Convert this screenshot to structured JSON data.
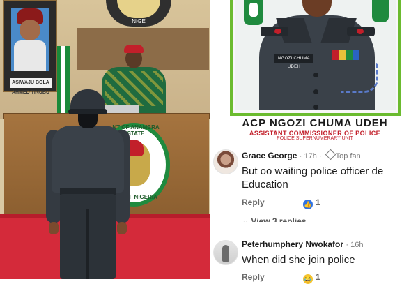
{
  "left_photo": {
    "portrait_caption": "ASIWAJU BOLA AHMED TINUBU",
    "seal_text": "NIGE",
    "crest_top_text": "NT OF ANAMBRA STATE",
    "crest_bottom_text": "LIC OF NIGERIA"
  },
  "id_card": {
    "nameplate": "NGOZI CHUMA UDEH",
    "name": "ACP NGOZI  CHUMA UDEH",
    "rank": "ASSISTANT COMMISSIONER OF POLICE",
    "unit": "POLICE SUPERNUMERARY UNIT"
  },
  "comments": [
    {
      "author": "Grace George",
      "time": "17h",
      "badge": "Top fan",
      "text": "But oo  waiting police officer de Education",
      "reply_label": "Reply",
      "reaction_count": "1",
      "reaction_icon": "like-icon",
      "replies_link": "View 3 replies"
    },
    {
      "author": "Peterhumphery Nwokafor",
      "time": "16h",
      "text": "When did she join police",
      "reply_label": "Reply",
      "reaction_count": "1",
      "reaction_icon": "haha-icon"
    }
  ],
  "colors": {
    "id_border": "#6bbb2f",
    "rank_text": "#c21f2a",
    "like": "#2f72e4",
    "haha": "#f4c430"
  }
}
